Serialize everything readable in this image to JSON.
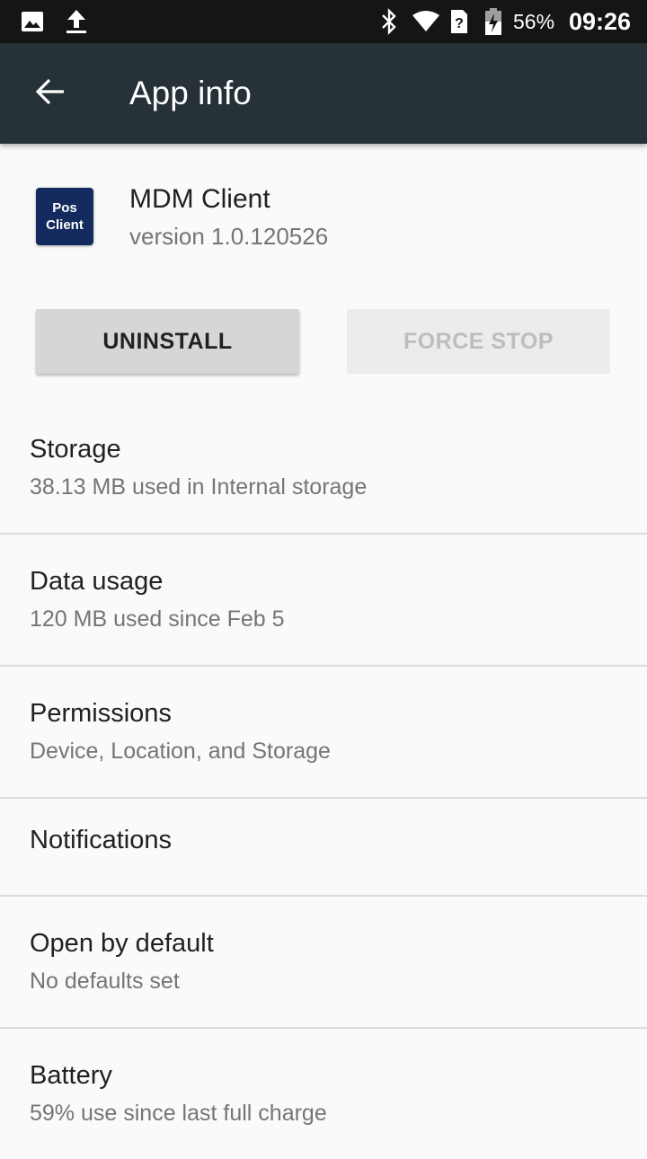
{
  "status_bar": {
    "left_icons": [
      "image-notification-icon",
      "upload-icon"
    ],
    "right_icons": [
      "bluetooth-icon",
      "wifi-icon",
      "no-sim-icon",
      "battery-charging-icon"
    ],
    "battery_percent": "56%",
    "time": "09:26"
  },
  "app_bar": {
    "title": "App info",
    "back_icon": "arrow-back-icon",
    "color": "#263238"
  },
  "app": {
    "icon_text_line1": "Pos",
    "icon_text_line2": "Client",
    "icon_color": "#132a5e",
    "name": "MDM Client",
    "version": "version 1.0.120526"
  },
  "buttons": {
    "uninstall": "UNINSTALL",
    "force_stop": "FORCE STOP",
    "force_stop_enabled": false
  },
  "settings": [
    {
      "title": "Storage",
      "subtitle": "38.13 MB used in Internal storage"
    },
    {
      "title": "Data usage",
      "subtitle": "120 MB used since Feb 5"
    },
    {
      "title": "Permissions",
      "subtitle": "Device, Location, and Storage"
    },
    {
      "title": "Notifications",
      "subtitle": ""
    },
    {
      "title": "Open by default",
      "subtitle": "No defaults set"
    },
    {
      "title": "Battery",
      "subtitle": "59% use since last full charge"
    }
  ]
}
